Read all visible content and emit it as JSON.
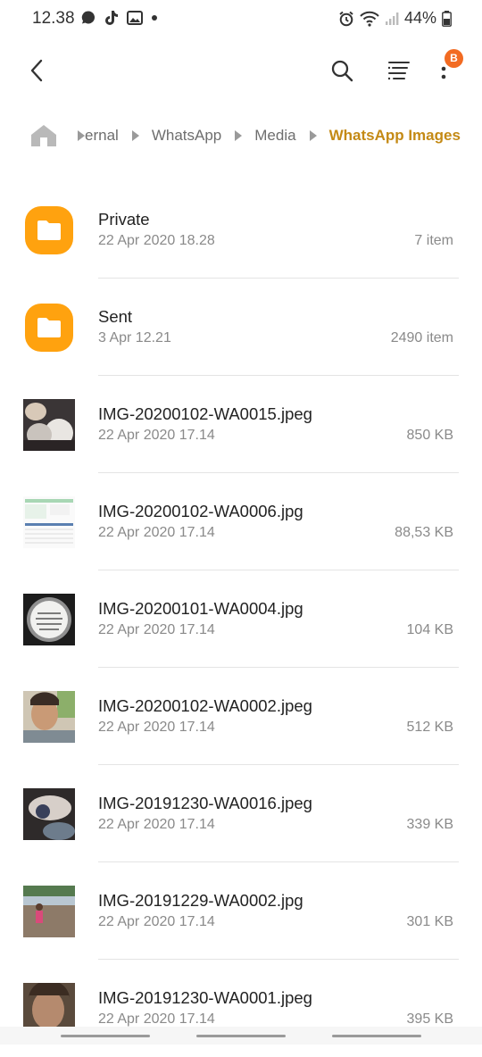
{
  "status_bar": {
    "time": "12.38",
    "battery_percent": "44%",
    "left_icons": [
      "chat-bubble-icon",
      "tiktok-icon",
      "gallery-icon",
      "dot-icon"
    ],
    "right_icons": [
      "alarm-icon",
      "wifi-icon",
      "signal-icon",
      "battery-icon"
    ]
  },
  "app_bar": {
    "back_icon": "chevron-left-icon",
    "search_icon": "search-icon",
    "sort_icon": "sort-list-icon",
    "more_icon": "more-vertical-icon",
    "badge": "B",
    "badge_color": "#f26b22"
  },
  "breadcrumb": {
    "home_icon": "home-icon",
    "items": [
      {
        "label": "ernal"
      },
      {
        "label": "WhatsApp"
      },
      {
        "label": "Media"
      },
      {
        "label": "WhatsApp Images"
      }
    ],
    "current_color": "#c48a15"
  },
  "files": [
    {
      "name": "Private",
      "date": "22 Apr 2020 18.28",
      "size": "7 item",
      "kind": "folder"
    },
    {
      "name": "Sent",
      "date": "3 Apr 12.21",
      "size": "2490 item",
      "kind": "folder"
    },
    {
      "name": "IMG-20200102-WA0015.jpeg",
      "date": "22 Apr 2020 17.14",
      "size": "850 KB",
      "kind": "image"
    },
    {
      "name": "IMG-20200102-WA0006.jpg",
      "date": "22 Apr 2020 17.14",
      "size": "88,53 KB",
      "kind": "image"
    },
    {
      "name": "IMG-20200101-WA0004.jpg",
      "date": "22 Apr 2020 17.14",
      "size": "104 KB",
      "kind": "image"
    },
    {
      "name": "IMG-20200102-WA0002.jpeg",
      "date": "22 Apr 2020 17.14",
      "size": "512 KB",
      "kind": "image"
    },
    {
      "name": "IMG-20191230-WA0016.jpeg",
      "date": "22 Apr 2020 17.14",
      "size": "339 KB",
      "kind": "image"
    },
    {
      "name": "IMG-20191229-WA0002.jpg",
      "date": "22 Apr 2020 17.14",
      "size": "301 KB",
      "kind": "image"
    },
    {
      "name": "IMG-20191230-WA0001.jpeg",
      "date": "22 Apr 2020 17.14",
      "size": "395 KB",
      "kind": "image"
    }
  ],
  "colors": {
    "folder": "#ffa20f",
    "secondary_text": "#8a8a8a"
  }
}
